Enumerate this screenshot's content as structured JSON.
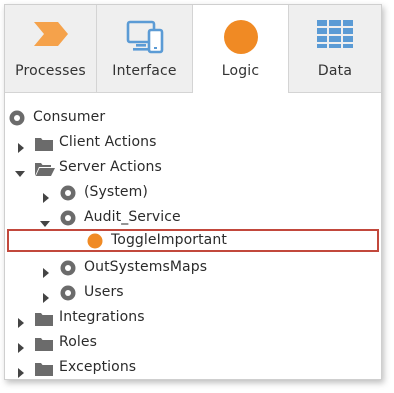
{
  "tabs": [
    {
      "label": "Processes",
      "icon": "processes-chevron-icon"
    },
    {
      "label": "Interface",
      "icon": "devices-icon"
    },
    {
      "label": "Logic",
      "icon": "logic-circle-icon"
    },
    {
      "label": "Data",
      "icon": "table-grid-icon"
    }
  ],
  "tree": {
    "root": "Consumer",
    "client_actions": "Client Actions",
    "server_actions": "Server Actions",
    "system": "(System)",
    "audit_service": "Audit_Service",
    "toggle_important": "ToggleImportant",
    "outsystems_maps": "OutSystemsMaps",
    "users": "Users",
    "integrations": "Integrations",
    "roles": "Roles",
    "exceptions": "Exceptions"
  },
  "colors": {
    "accent_orange": "#f08a24",
    "icon_blue": "#5b9bd5",
    "highlight_border": "#c2483c",
    "folder_gray": "#6b6b6b"
  }
}
